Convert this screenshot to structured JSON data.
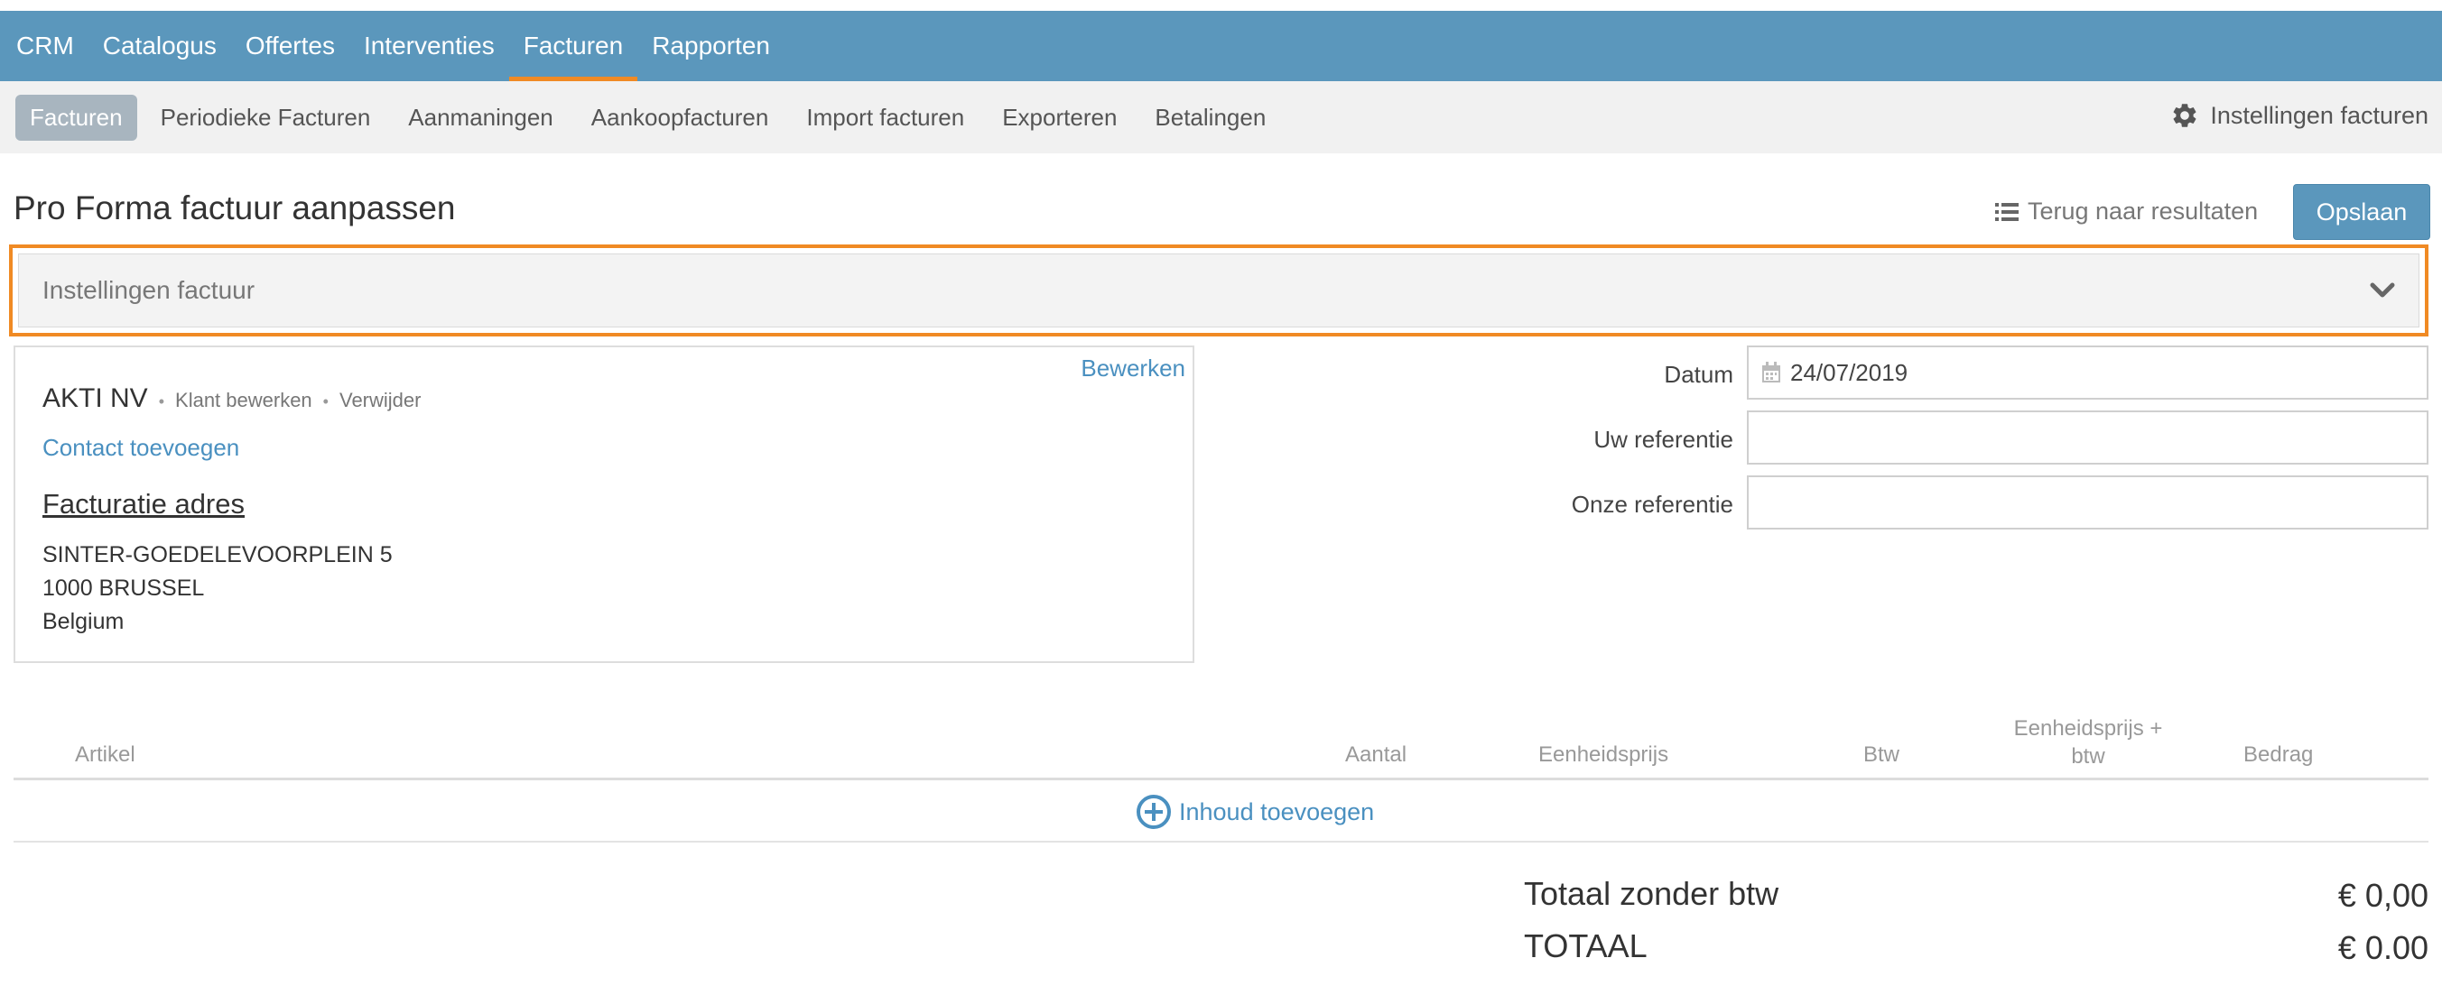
{
  "top_nav": {
    "items": [
      {
        "label": "CRM"
      },
      {
        "label": "Catalogus"
      },
      {
        "label": "Offertes"
      },
      {
        "label": "Interventies"
      },
      {
        "label": "Facturen",
        "active": true
      },
      {
        "label": "Rapporten"
      }
    ]
  },
  "sub_nav": {
    "items": [
      {
        "label": "Facturen",
        "active": true
      },
      {
        "label": "Periodieke Facturen"
      },
      {
        "label": "Aanmaningen"
      },
      {
        "label": "Aankoopfacturen"
      },
      {
        "label": "Import facturen"
      },
      {
        "label": "Exporteren"
      },
      {
        "label": "Betalingen"
      }
    ],
    "settings_label": "Instellingen facturen",
    "settings_icon": "gear-icon"
  },
  "page": {
    "title": "Pro Forma factuur aanpassen",
    "back_label": "Terug naar resultaten",
    "back_icon": "list-icon",
    "save_label": "Opslaan"
  },
  "settings_panel": {
    "label": "Instellingen factuur",
    "icon": "chevron-down-icon"
  },
  "client": {
    "edit_label": "Bewerken",
    "name": "AKTI NV",
    "edit_client_label": "Klant bewerken",
    "remove_label": "Verwijder",
    "add_contact_label": "Contact toevoegen",
    "address_title": "Facturatie adres",
    "address_line1": "SINTER-GOEDELEVOORPLEIN 5",
    "address_line2": "1000 BRUSSEL",
    "address_line3": "Belgium"
  },
  "form": {
    "date_label": "Datum",
    "date_value": "24/07/2019",
    "date_icon": "calendar-icon",
    "your_ref_label": "Uw referentie",
    "your_ref_value": "",
    "our_ref_label": "Onze referentie",
    "our_ref_value": ""
  },
  "table": {
    "headers": {
      "article": "Artikel",
      "quantity": "Aantal",
      "unit_price": "Eenheidsprijs",
      "vat": "Btw",
      "unit_price_vat_line1": "Eenheidsprijs +",
      "unit_price_vat_line2": "btw",
      "amount": "Bedrag"
    },
    "add_content_label": "Inhoud toevoegen",
    "add_content_icon": "plus-circle-icon"
  },
  "totals": {
    "subtotal_label": "Totaal zonder btw",
    "subtotal_value": "€ 0,00",
    "total_label": "TOTAAL",
    "total_value": "€ 0.00"
  },
  "colors": {
    "nav_bg": "#5b97bc",
    "accent": "#f08a24",
    "link": "#4a90c0",
    "save_button": "#5b97bc"
  }
}
